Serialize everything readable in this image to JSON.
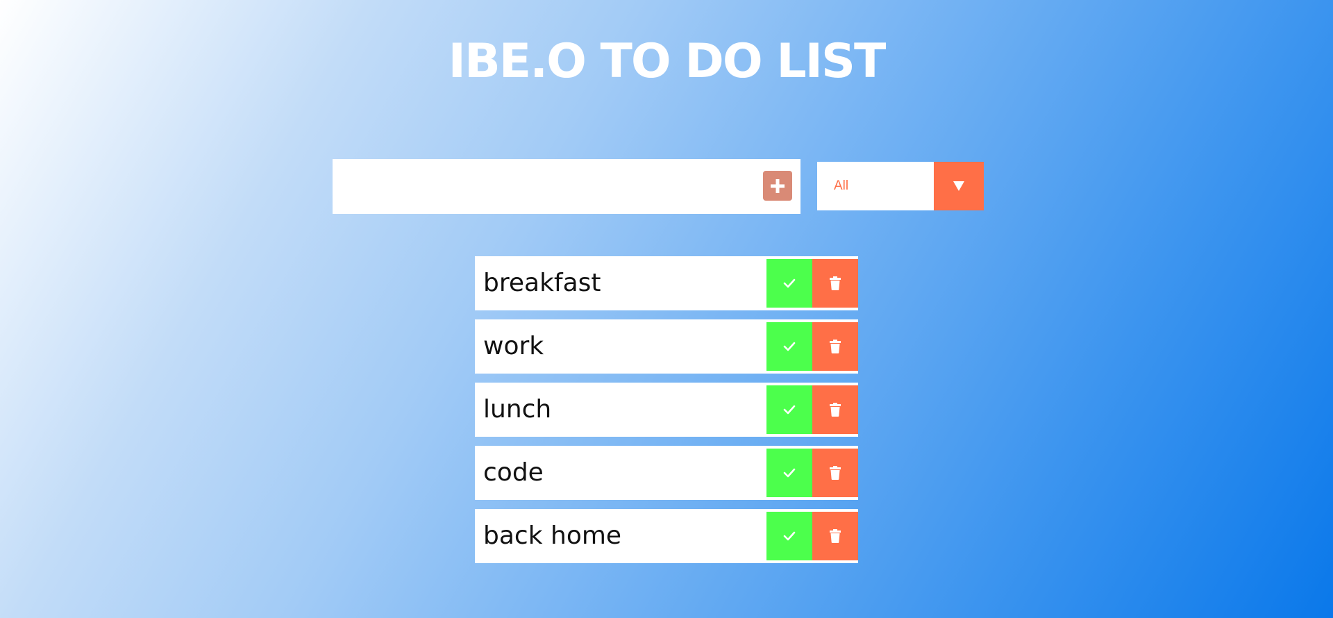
{
  "app": {
    "title": "IBE.O TO DO LIST"
  },
  "input": {
    "value": "",
    "placeholder": "",
    "add_icon": "plus-icon"
  },
  "filter": {
    "selected": "All",
    "arrow_icon": "caret-down-icon"
  },
  "todos": [
    {
      "text": "breakfast"
    },
    {
      "text": "work"
    },
    {
      "text": "lunch"
    },
    {
      "text": "code"
    },
    {
      "text": "back home"
    }
  ],
  "colors": {
    "accent": "#ff6f47",
    "complete": "#4cff4c",
    "add_button": "#d98a76"
  }
}
